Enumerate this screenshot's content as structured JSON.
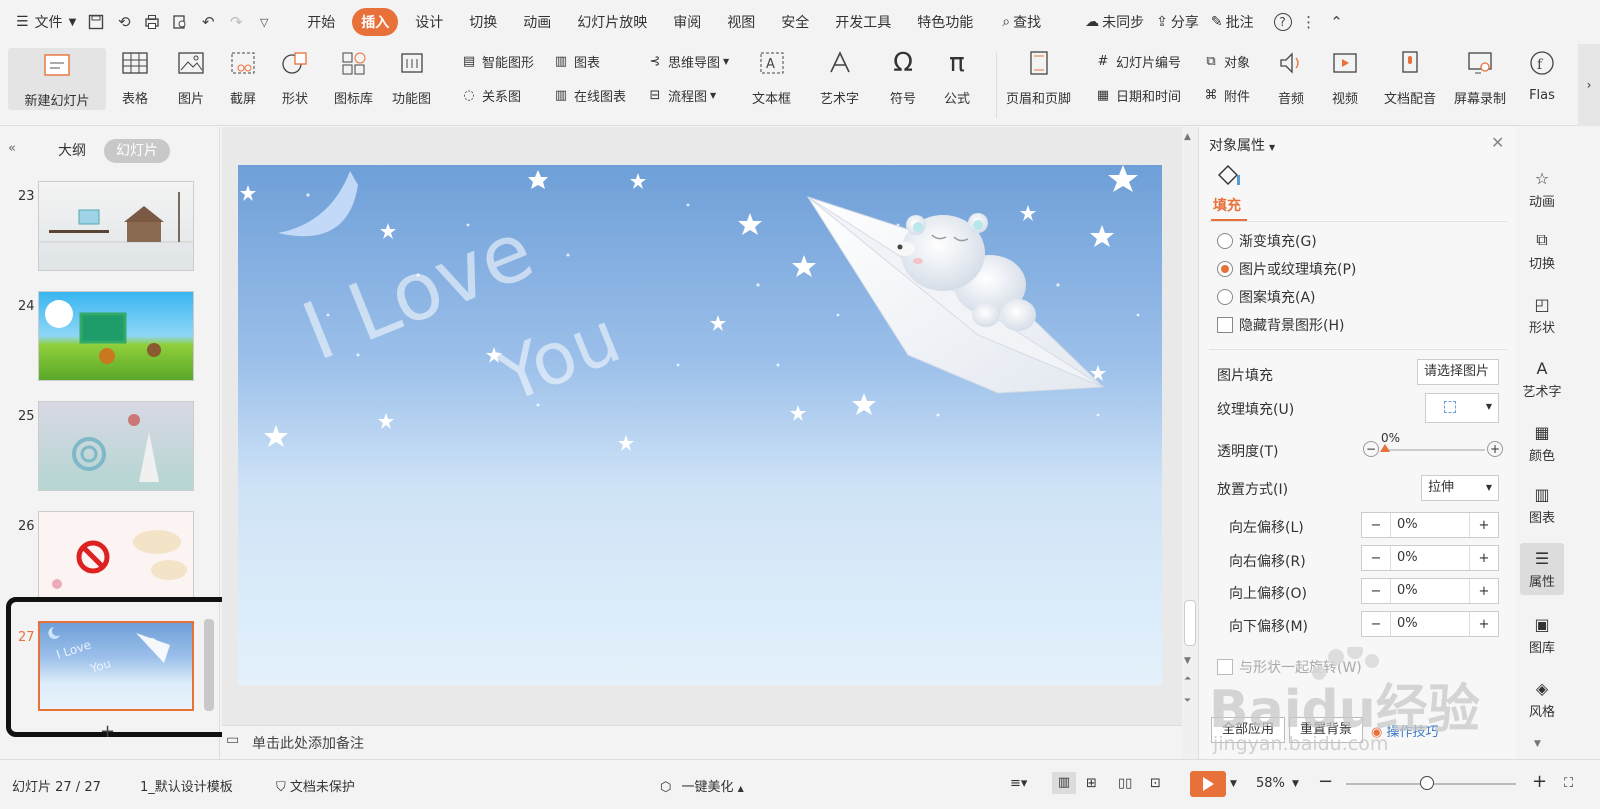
{
  "titlebar": {
    "file_label": "文件",
    "menu_tabs": [
      "开始",
      "插入",
      "设计",
      "切换",
      "动画",
      "幻灯片放映",
      "审阅",
      "视图",
      "安全",
      "开发工具",
      "特色功能"
    ],
    "active_tab": "插入",
    "search_label": "查找",
    "sync_label": "未同步",
    "share_label": "分享",
    "comment_label": "批注"
  },
  "ribbon": {
    "new_slide": "新建幻灯片",
    "table": "表格",
    "picture": "图片",
    "screenshot": "截屏",
    "shape": "形状",
    "icon_lib": "图标库",
    "func_chart": "功能图",
    "smart_art": "智能图形",
    "chart": "图表",
    "relation": "关系图",
    "online_chart": "在线图表",
    "mindmap": "思维导图",
    "flowchart": "流程图",
    "textbox": "文本框",
    "wordart": "艺术字",
    "symbol": "符号",
    "formula": "公式",
    "header_footer": "页眉和页脚",
    "slide_number": "幻灯片编号",
    "datetime": "日期和时间",
    "object": "对象",
    "attachment": "附件",
    "audio": "音频",
    "video": "视频",
    "narration": "文档配音",
    "screen_record": "屏幕录制",
    "flash": "Flas"
  },
  "leftpanel": {
    "tab_outline": "大纲",
    "tab_slides": "幻灯片",
    "slides": [
      {
        "num": "23"
      },
      {
        "num": "24"
      },
      {
        "num": "25"
      },
      {
        "num": "26"
      },
      {
        "num": "27"
      }
    ]
  },
  "slide": {
    "text_line1": "I Love",
    "text_line2": "You"
  },
  "notes": {
    "placeholder": "单击此处添加备注"
  },
  "rightpanel": {
    "title": "对象属性",
    "fill_tab": "填充",
    "opt_gradient": "渐变填充(G)",
    "opt_picture": "图片或纹理填充(P)",
    "opt_pattern": "图案填充(A)",
    "opt_hide_bg": "隐藏背景图形(H)",
    "picture_fill_label": "图片填充",
    "picture_fill_btn": "请选择图片",
    "texture_label": "纹理填充(U)",
    "transparency_label": "透明度(T)",
    "transparency_value": "0%",
    "transparency_fraction": 0,
    "placement_label": "放置方式(I)",
    "placement_value": "拉伸",
    "offset_left_label": "向左偏移(L)",
    "offset_right_label": "向右偏移(R)",
    "offset_up_label": "向上偏移(O)",
    "offset_down_label": "向下偏移(M)",
    "offset_left": "0%",
    "offset_right": "0%",
    "offset_up": "0%",
    "offset_down": "0%",
    "rotate_with_shape": "与形状一起旋转(W)",
    "apply_all": "全部应用",
    "reset_bg": "重置背景",
    "tips": "操作技巧"
  },
  "rightbar": [
    "动画",
    "切换",
    "形状",
    "艺术字",
    "颜色",
    "图表",
    "属性",
    "图库",
    "风格"
  ],
  "statusbar": {
    "slide_info": "幻灯片 27 / 27",
    "template": "1_默认设计模板",
    "protect": "文档未保护",
    "beautify": "一键美化",
    "zoom": "58%",
    "zoom_fraction": 0.58
  },
  "watermark": {
    "brand": "Baidu经验",
    "url": "jingyan.baidu.com"
  },
  "colors": {
    "accent": "#e8713a",
    "highlight_box": "#111111"
  }
}
